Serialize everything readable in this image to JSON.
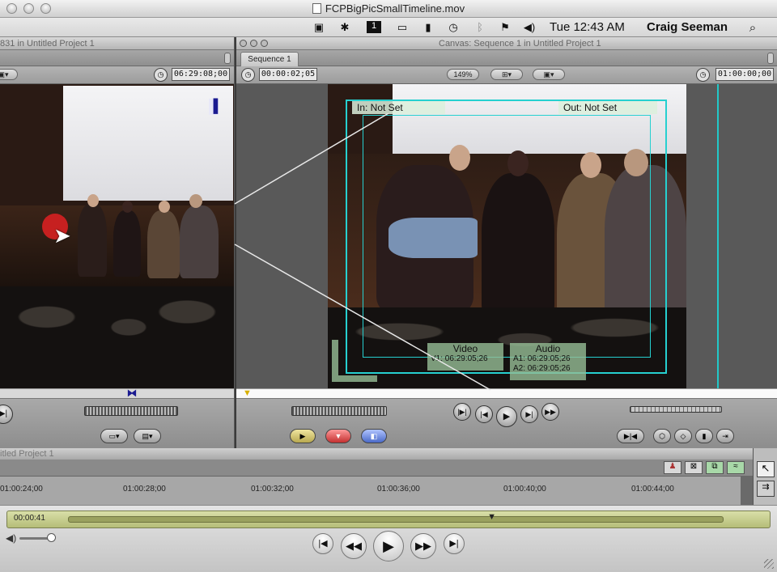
{
  "window": {
    "title": "FCPBigPicSmallTimeline.mov"
  },
  "menubar": {
    "time": "Tue 12:43 AM",
    "user": "Craig Seeman"
  },
  "viewer": {
    "title": "831 in Untitled Project 1",
    "timecode": "06:29:08;00"
  },
  "canvas": {
    "title": "Canvas: Sequence 1 in Untitled Project 1",
    "tab": "Sequence 1",
    "timecode_current": "00:00:02;05",
    "zoom": "149%",
    "timecode_duration": "01:00:00;00",
    "in_label": "In: Not Set",
    "out_label": "Out: Not Set",
    "video_label": "Video",
    "video_tc": "V1: 06:29:05;26",
    "audio_label": "Audio",
    "audio_tc_1": "A1: 06:29:05;26",
    "audio_tc_2": "A2: 06:29:05;26"
  },
  "timeline": {
    "title": "itled Project 1",
    "ruler": [
      "01:00:24;00",
      "01:00:28;00",
      "01:00:32;00",
      "01:00:36;00",
      "01:00:40;00",
      "01:00:44;00"
    ]
  },
  "quicktime": {
    "elapsed": "00:00:41",
    "playhead_fraction": 0.635
  }
}
